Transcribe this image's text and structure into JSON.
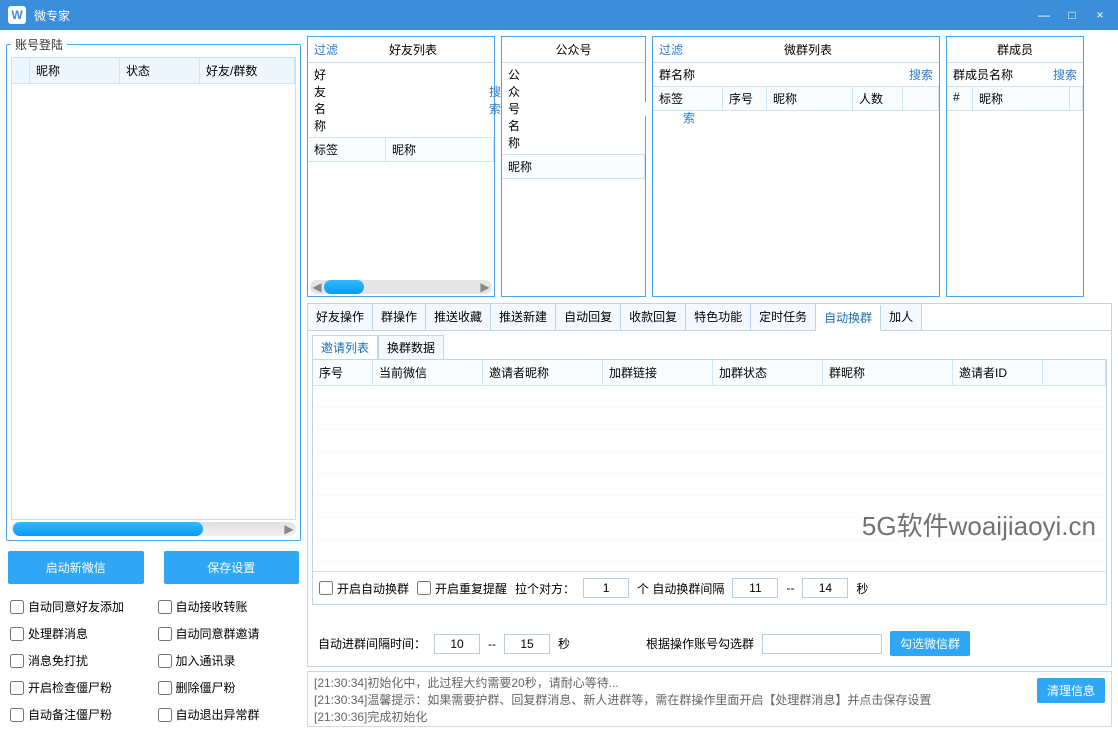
{
  "app": {
    "title": "微专家",
    "logo": "W"
  },
  "winbtns": {
    "min": "—",
    "max": "□",
    "close": "×"
  },
  "left": {
    "legend": "账号登陆",
    "cols": {
      "nick": "昵称",
      "status": "状态",
      "count": "好友/群数"
    },
    "start_btn": "启动新微信",
    "save_btn": "保存设置",
    "checks": {
      "auto_accept_friend": "自动同意好友添加",
      "auto_accept_transfer": "自动接收转账",
      "handle_group_msg": "处理群消息",
      "auto_accept_group_invite": "自动同意群邀请",
      "msg_no_disturb": "消息免打扰",
      "add_contacts": "加入通讯录",
      "check_zombie": "开启检查僵尸粉",
      "del_zombie": "删除僵尸粉",
      "note_zombie": "自动备注僵尸粉",
      "auto_quit_abnormal": "自动退出异常群"
    }
  },
  "panels": {
    "friends": {
      "filter": "过滤",
      "title": "好友列表",
      "namelbl": "好友名称",
      "search": "搜索",
      "col_tag": "标签",
      "col_nick": "昵称"
    },
    "official": {
      "title": "公众号",
      "namelbl": "公众号名称",
      "search": "搜索",
      "col_nick": "昵称"
    },
    "groups": {
      "filter": "过滤",
      "title": "微群列表",
      "namelbl": "群名称",
      "search": "搜索",
      "col_tag": "标签",
      "col_seq": "序号",
      "col_nick": "昵称",
      "col_count": "人数"
    },
    "members": {
      "title": "群成员",
      "namelbl": "群成员名称",
      "search": "搜索",
      "col_idx": "#",
      "col_nick": "昵称"
    }
  },
  "tabs": {
    "list": [
      "好友操作",
      "群操作",
      "推送收藏",
      "推送新建",
      "自动回复",
      "收款回复",
      "特色功能",
      "定时任务",
      "自动换群",
      "加人"
    ],
    "active": "自动换群"
  },
  "inner_tabs": {
    "list": [
      "邀请列表",
      "换群数据"
    ],
    "active": "邀请列表"
  },
  "grid_cols": {
    "seq": "序号",
    "curwx": "当前微信",
    "inviter_nick": "邀请者昵称",
    "join_link": "加群链接",
    "join_status": "加群状态",
    "group_nick": "群昵称",
    "inviter_id": "邀请者ID"
  },
  "ctrl": {
    "enable_switch": "开启自动换群",
    "enable_remind": "开启重复提醒",
    "pull_label_a": "拉个对方：",
    "pull_value": "1",
    "pull_label_b": "个  自动换群间隔",
    "interval_from": "11",
    "dash": "--",
    "interval_to": "14",
    "sec": "秒",
    "join_interval_label": "自动进群间隔时间：",
    "join_from": "10",
    "join_to": "15",
    "select_by_acct": "根据操作账号勾选群",
    "select_wx_btn": "勾选微信群"
  },
  "log": {
    "l1": "[21:30:34]初始化中，此过程大约需要20秒，请耐心等待...",
    "l2": "[21:30:34]温馨提示：如果需要护群、回复群消息、新人进群等，需在群操作里面开启【处理群消息】并点击保存设置",
    "l3": "[21:30:36]完成初始化",
    "clean": "清理信息"
  },
  "watermark": "5G软件woaijiaoyi.cn"
}
